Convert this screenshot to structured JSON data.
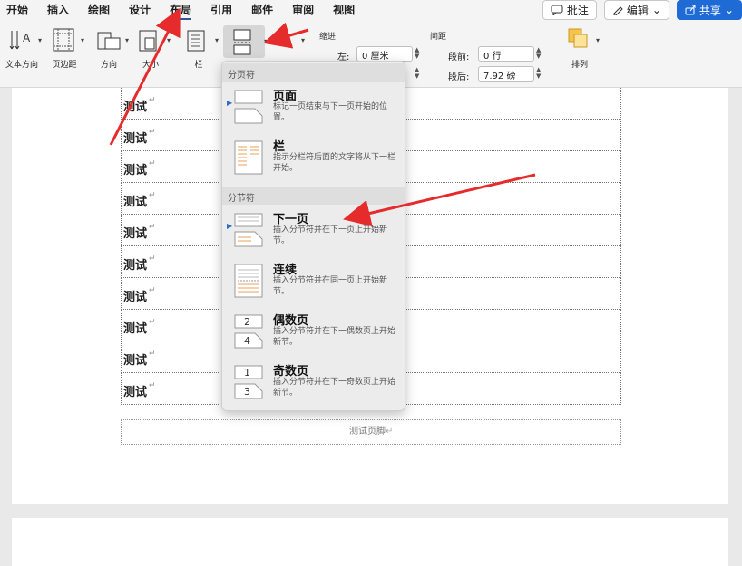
{
  "ribbon": {
    "tabs": [
      "开始",
      "插入",
      "绘图",
      "设计",
      "布局",
      "引用",
      "邮件",
      "审阅",
      "视图"
    ],
    "active_tab_index": 4,
    "comment_label": "批注",
    "edit_label": "编辑",
    "share_label": "共享",
    "tools": {
      "text_direction": "文本方向",
      "margins": "页边距",
      "orientation": "方向",
      "size": "大小",
      "columns": "栏",
      "arrange": "排列"
    },
    "indent_label": "缩进",
    "spacing_label": "间距",
    "left_label": "左:",
    "left_value": "0 厘米",
    "before_label": "段前:",
    "before_value": "0 行",
    "after_label": "段后:",
    "after_value": "7.92 磅"
  },
  "document": {
    "rows": [
      "测试",
      "测试",
      "测试",
      "测试",
      "测试",
      "测试",
      "测试",
      "测试",
      "测试",
      "测试"
    ],
    "footer": "测试页脚"
  },
  "menu": {
    "section_page_breaks": "分页符",
    "section_section_breaks": "分节符",
    "items": [
      {
        "title": "页面",
        "desc": "标记一页结束与下一页开始的位置。"
      },
      {
        "title": "栏",
        "desc": "指示分栏符后面的文字将从下一栏开始。"
      },
      {
        "title": "下一页",
        "desc": "插入分节符并在下一页上开始新节。"
      },
      {
        "title": "连续",
        "desc": "插入分节符并在同一页上开始新节。"
      },
      {
        "title": "偶数页",
        "desc": "插入分节符并在下一偶数页上开始新节。"
      },
      {
        "title": "奇数页",
        "desc": "插入分节符并在下一奇数页上开始新节。"
      }
    ]
  },
  "colors": {
    "accent": "#1e6bd6",
    "annotation": "#e52b2b"
  }
}
